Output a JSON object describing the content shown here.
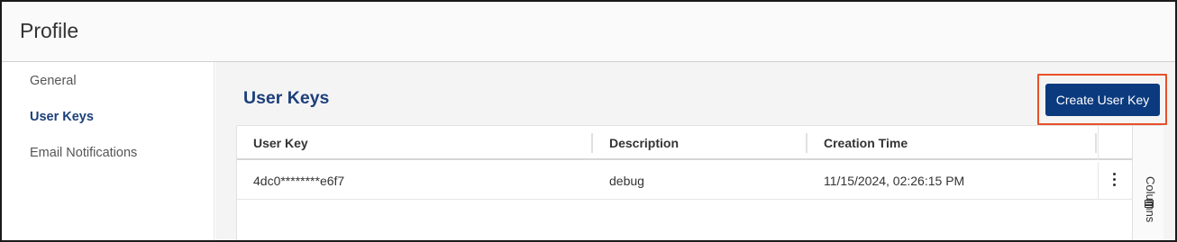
{
  "page": {
    "title": "Profile"
  },
  "sidebar": {
    "items": [
      {
        "label": "General",
        "active": false
      },
      {
        "label": "User Keys",
        "active": true
      },
      {
        "label": "Email Notifications",
        "active": false
      }
    ]
  },
  "main": {
    "section_title": "User Keys",
    "create_button_label": "Create User Key"
  },
  "table": {
    "columns": [
      "User Key",
      "Description",
      "Creation Time"
    ],
    "rows": [
      {
        "user_key": "4dc0********e6f7",
        "description": "debug",
        "creation_time": "11/15/2024, 02:26:15 PM"
      }
    ],
    "columns_toggle_label": "Columns"
  },
  "colors": {
    "accent": "#1c3f7a",
    "button": "#0b3a7e",
    "highlight_outline": "#e8502a"
  },
  "icons": {
    "row_menu": "kebab-icon",
    "columns": "columns-icon"
  }
}
